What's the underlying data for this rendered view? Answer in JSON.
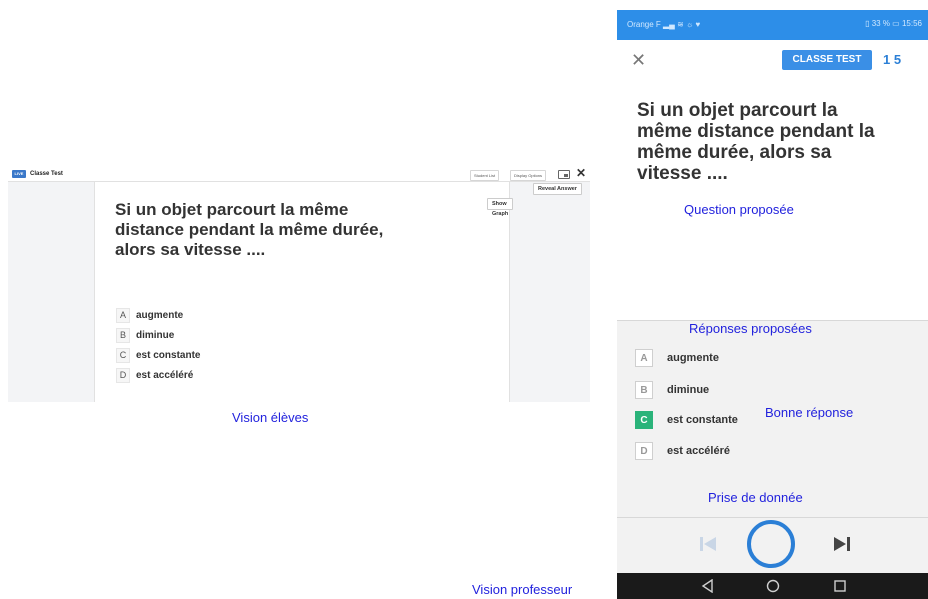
{
  "student_view": {
    "topbar": {
      "live_badge": "LIVE",
      "title": "Classe Test",
      "student_list_label": "Student List",
      "display_options_label": "Display Options"
    },
    "actions": {
      "show_graph": "Show Graph",
      "reveal_answer": "Reveal Answer"
    },
    "question": "Si un objet parcourt la même distance pendant la même durée, alors sa vitesse ....",
    "answers": [
      {
        "letter": "A",
        "text": "augmente"
      },
      {
        "letter": "B",
        "text": "diminue"
      },
      {
        "letter": "C",
        "text": "est constante"
      },
      {
        "letter": "D",
        "text": "est accéléré"
      }
    ],
    "caption": "Vision élèves"
  },
  "teacher_view": {
    "status_bar": {
      "carrier": "Orange F",
      "battery": "33 %",
      "time": "15:56"
    },
    "class_badge": "CLASSE TEST",
    "count": "1 5",
    "question": "Si un objet parcourt la même distance pendant la même durée, alors sa vitesse ....",
    "answers": [
      {
        "letter": "A",
        "text": "augmente",
        "correct": false
      },
      {
        "letter": "B",
        "text": "diminue",
        "correct": false
      },
      {
        "letter": "C",
        "text": "est constante",
        "correct": true
      },
      {
        "letter": "D",
        "text": "est accéléré",
        "correct": false
      }
    ],
    "icons": [
      "close-icon",
      "previous-icon",
      "record-button-icon",
      "next-icon",
      "back-icon",
      "home-icon",
      "recents-icon"
    ],
    "accent_color": "#2b7fd6",
    "correct_color": "#2ab37a"
  },
  "annotations": {
    "question_label": "Question proposée",
    "answers_label": "Réponses proposées",
    "correct_label": "Bonne réponse",
    "data_capture_label": "Prise de donnée",
    "teacher_caption": "Vision professeur"
  }
}
